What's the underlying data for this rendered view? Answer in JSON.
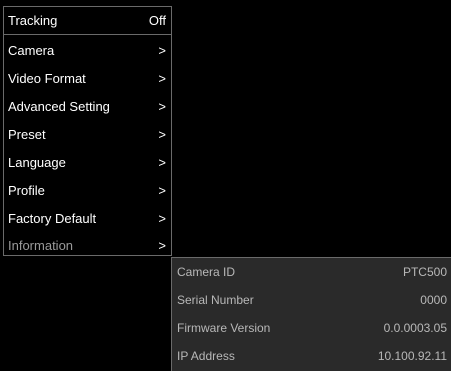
{
  "menu": {
    "items": [
      {
        "label": "Tracking",
        "value": "Off"
      },
      {
        "label": "Camera",
        "value": ">"
      },
      {
        "label": "Video Format",
        "value": ">"
      },
      {
        "label": "Advanced Setting",
        "value": ">"
      },
      {
        "label": "Preset",
        "value": ">"
      },
      {
        "label": "Language",
        "value": ">"
      },
      {
        "label": "Profile",
        "value": ">"
      },
      {
        "label": "Factory Default",
        "value": ">"
      },
      {
        "label": "Information",
        "value": ">"
      }
    ]
  },
  "info": {
    "rows": [
      {
        "label": "Camera ID",
        "value": "PTC500"
      },
      {
        "label": "Serial Number",
        "value": "0000"
      },
      {
        "label": "Firmware Version",
        "value": "0.0.0003.05"
      },
      {
        "label": "IP Address",
        "value": "10.100.92.11"
      }
    ]
  }
}
